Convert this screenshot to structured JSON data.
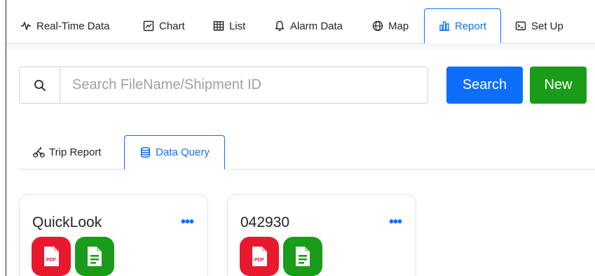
{
  "topnav": {
    "tabs": [
      {
        "label": "Real-Time Data",
        "icon": "pulse-icon"
      },
      {
        "label": "Chart",
        "icon": "line-chart-icon"
      },
      {
        "label": "List",
        "icon": "table-icon"
      },
      {
        "label": "Alarm Data",
        "icon": "bell-icon"
      },
      {
        "label": "Map",
        "icon": "globe-icon"
      },
      {
        "label": "Report",
        "icon": "bar-chart-icon",
        "active": true
      },
      {
        "label": "Set Up",
        "icon": "terminal-icon"
      }
    ]
  },
  "search": {
    "placeholder": "Search FileName/Shipment ID",
    "value": "",
    "search_label": "Search",
    "new_label": "New"
  },
  "subnav": {
    "tabs": [
      {
        "label": "Trip Report",
        "icon": "bicycle-icon"
      },
      {
        "label": "Data Query",
        "icon": "database-icon",
        "active": true
      }
    ]
  },
  "cards": [
    {
      "title": "QuickLook",
      "menu": "•••",
      "pdf_label": "PDF"
    },
    {
      "title": "042930",
      "menu": "•••",
      "pdf_label": "PDF"
    }
  ],
  "colors": {
    "primary": "#0d6efd",
    "success": "#1a9b1a",
    "danger": "#e8192e"
  }
}
